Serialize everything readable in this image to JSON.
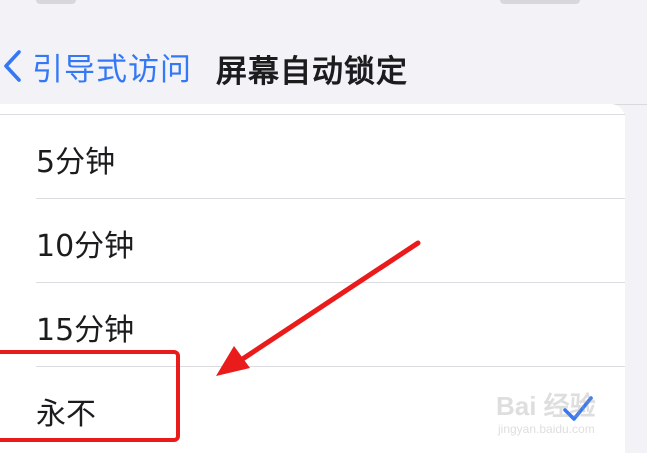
{
  "nav": {
    "back_label": "引导式访问",
    "title": "屏幕自动锁定"
  },
  "options": [
    {
      "label": "5分钟",
      "selected": false
    },
    {
      "label": "10分钟",
      "selected": false
    },
    {
      "label": "15分钟",
      "selected": false
    },
    {
      "label": "永不",
      "selected": true
    }
  ],
  "icons": {
    "back": "chevron-left-icon",
    "selected": "checkmark-icon"
  },
  "colors": {
    "accent": "#3478f6",
    "annotation": "#ea1b1b",
    "background": "#f2f2f7",
    "card": "#ffffff"
  },
  "watermark": {
    "main": "Bai 经验",
    "sub": "jingyan.baidu.com"
  }
}
